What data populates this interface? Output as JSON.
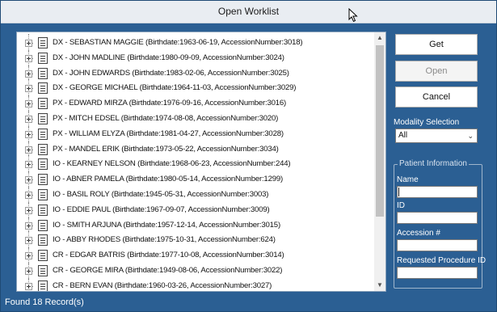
{
  "window": {
    "title": "Open Worklist"
  },
  "records": [
    "DX - SEBASTIAN MAGGIE (Birthdate:1963-06-19, AccessionNumber:3018)",
    "DX - JOHN MADLINE (Birthdate:1980-09-09, AccessionNumber:3024)",
    "DX - JOHN EDWARDS (Birthdate:1983-02-06, AccessionNumber:3025)",
    "DX - GEORGE MICHAEL (Birthdate:1964-11-03, AccessionNumber:3029)",
    "PX - EDWARD MIRZA (Birthdate:1976-09-16, AccessionNumber:3016)",
    "PX - MITCH EDSEL (Birthdate:1974-08-08, AccessionNumber:3020)",
    "PX - WILLIAM ELYZA (Birthdate:1981-04-27, AccessionNumber:3028)",
    "PX - MANDEL ERIK (Birthdate:1973-05-22, AccessionNumber:3034)",
    "IO - KEARNEY NELSON (Birthdate:1968-06-23, AccessionNumber:244)",
    "IO - ABNER PAMELA (Birthdate:1980-05-14, AccessionNumber:1299)",
    "IO - BASIL ROLY (Birthdate:1945-05-31, AccessionNumber:3003)",
    "IO - EDDIE PAUL (Birthdate:1967-09-07, AccessionNumber:3009)",
    "IO - SMITH ARJUNA (Birthdate:1957-12-14, AccessionNumber:3015)",
    "IO - ABBY RHODES (Birthdate:1975-10-31, AccessionNumber:624)",
    "CR - EDGAR BATRIS (Birthdate:1977-10-08, AccessionNumber:3014)",
    "CR - GEORGE MIRA (Birthdate:1949-08-06, AccessionNumber:3022)",
    "CR - BERN EVAN (Birthdate:1960-03-26, AccessionNumber:3027)"
  ],
  "buttons": {
    "get": "Get",
    "open": "Open",
    "cancel": "Cancel"
  },
  "modality": {
    "label": "Modality Selection",
    "selected": "All"
  },
  "patient_info": {
    "title": "Patient Information",
    "name_label": "Name",
    "name_value": "",
    "id_label": "ID",
    "id_value": "",
    "accession_label": "Accession #",
    "accession_value": "",
    "requested_procedure_label": "Requested Procedure ID",
    "requested_procedure_value": ""
  },
  "status": {
    "text": "Found 18 Record(s)"
  },
  "colors": {
    "background": "#2b5f93",
    "titlebar": "#e9edf2",
    "list_bg": "#ffffff"
  }
}
